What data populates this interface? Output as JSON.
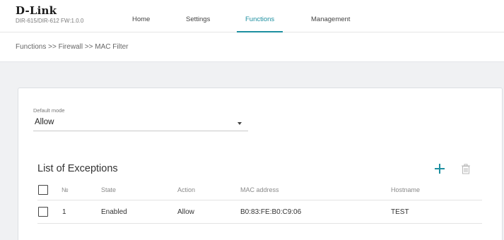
{
  "brand": {
    "logo": "D-Link",
    "model": "DIR-615/DIR-612 FW:1.0.0"
  },
  "nav": {
    "tabs": [
      {
        "label": "Home"
      },
      {
        "label": "Settings"
      },
      {
        "label": "Functions"
      },
      {
        "label": "Management"
      }
    ],
    "active": "Functions"
  },
  "breadcrumb": "Functions >>  Firewall >>  MAC Filter",
  "default_mode": {
    "label": "Default mode",
    "value": "Allow"
  },
  "exceptions": {
    "title": "List of Exceptions",
    "columns": [
      "№",
      "State",
      "Action",
      "MAC address",
      "Hostname"
    ],
    "rows": [
      {
        "num": "1",
        "state": "Enabled",
        "action": "Allow",
        "mac": "B0:83:FE:B0:C9:06",
        "hostname": "TEST"
      }
    ]
  },
  "icons": {
    "add": "plus-icon",
    "delete": "trash-icon",
    "dropdown": "caret-down-icon"
  },
  "colors": {
    "accent": "#1d8fa0",
    "band": "#f0f1f3"
  }
}
